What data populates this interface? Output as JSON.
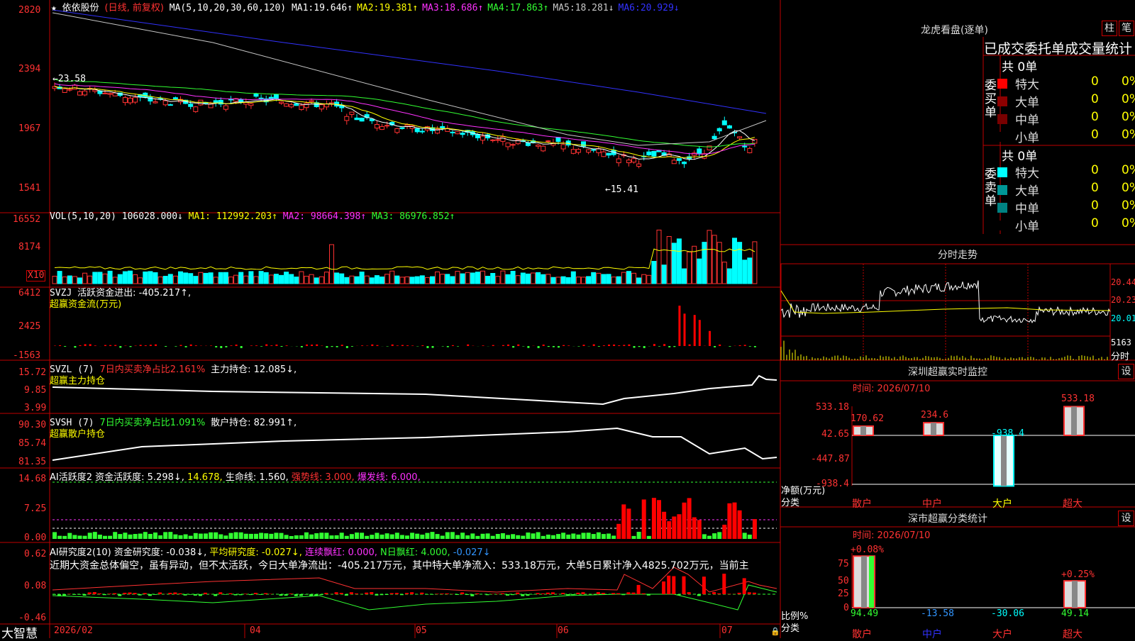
{
  "stock": {
    "title": "依依股份",
    "period": "(日线, 前复权)",
    "ma_label": "MA(5,10,20,30,60,120)",
    "ma": [
      {
        "name": "MA1:",
        "value": "19.646↑",
        "color": "#ffffff"
      },
      {
        "name": "MA2:",
        "value": "19.381↑",
        "color": "#ffff00"
      },
      {
        "name": "MA3:",
        "value": "18.686↑",
        "color": "#ff32ff"
      },
      {
        "name": "MA4:",
        "value": "17.863↑",
        "color": "#32ff32"
      },
      {
        "name": "MA5:",
        "value": "18.281↓",
        "color": "#c8c8c8"
      },
      {
        "name": "MA6:",
        "value": "20.929↓",
        "color": "#3232ff"
      }
    ],
    "y_ticks": [
      "2820",
      "2394",
      "1967",
      "1541"
    ],
    "high_label": "←23.58",
    "low_label": "←15.41"
  },
  "vol": {
    "label": "VOL(5,10,20)",
    "value": "106028.000↓",
    "ma1": "MA1: 112992.203↑",
    "ma2": "MA2: 98664.398↑",
    "ma3": "MA3: 86976.852↑",
    "y_ticks": [
      "16552",
      "8174"
    ],
    "unit": "X10"
  },
  "svzj": {
    "label": "SVZJ",
    "desc": "活跃资金进出: -405.217↑,",
    "sub": "超赢资金流(万元)",
    "y_ticks": [
      "6412",
      "2425",
      "-1563"
    ]
  },
  "svzl": {
    "label": "SVZL (7)",
    "ratio": "7日内买卖净占比2.161%",
    "hold": "主力持仓: 12.085↓,",
    "sub": "超赢主力持仓",
    "y_ticks": [
      "15.72",
      "9.85",
      "3.99"
    ]
  },
  "svsh": {
    "label": "SVSH (7)",
    "ratio": "7日内买卖净占比1.091%",
    "hold": "散户持仓: 82.991↑,",
    "sub": "超赢散户持仓",
    "y_ticks": [
      "90.30",
      "85.74",
      "81.35"
    ]
  },
  "ai1": {
    "label": "AI活跃度2",
    "a": "资金活跃度: 5.298↓,",
    "b": "14.678,",
    "c": "生命线: 1.560,",
    "d": "强势线: 3.000,",
    "e": "爆发线: 6.000,",
    "y_ticks": [
      "14.68",
      "7.25",
      "0.00"
    ]
  },
  "ai2": {
    "label": "AI研究度2(10)",
    "a": "资金研究度: -0.038↓,",
    "b": "平均研究度: -0.027↓,",
    "c": "连续飘红: 0.000,",
    "d": "N日飘红: 4.000,",
    "e": "-0.027↓",
    "comment": "近期大资金总体偏空，虽有异动，但不太活跃，今日大单净流出：-405.217万元，其中特大单净流入：533.18万元，大单5日累计净入4825.702万元，当前主",
    "y_ticks": [
      "0.62",
      "0.08",
      "-0.46"
    ]
  },
  "xaxis": {
    "brand": "大智慧",
    "labels": [
      "2026/02",
      "04",
      "05",
      "06",
      "07"
    ]
  },
  "dragon": {
    "title": "龙虎看盘(逐单)",
    "btn1": "柱",
    "btn2": "笔",
    "header": "已成交委托单成交量统计",
    "buy_label": "委买单",
    "sell_label": "委卖单",
    "buy_total": "共 0单",
    "sell_total": "共 0单",
    "buy_rows": [
      {
        "name": "特大",
        "v1": "0",
        "v2": "0%",
        "color": "#ff0000"
      },
      {
        "name": "大单",
        "v1": "0",
        "v2": "0%",
        "color": "#8c0000"
      },
      {
        "name": "中单",
        "v1": "0",
        "v2": "0%",
        "color": "#780000"
      },
      {
        "name": "小单",
        "v1": "0",
        "v2": "0%",
        "color": "#000000"
      }
    ],
    "sell_rows": [
      {
        "name": "特大",
        "v1": "0",
        "v2": "0%",
        "color": "#00ffff"
      },
      {
        "name": "大单",
        "v1": "0",
        "v2": "0%",
        "color": "#009696"
      },
      {
        "name": "中单",
        "v1": "0",
        "v2": "0%",
        "color": "#008282"
      },
      {
        "name": "小单",
        "v1": "0",
        "v2": "0%",
        "color": "#000000"
      }
    ]
  },
  "intraday": {
    "title": "分时走势",
    "y_ticks": [
      "20.44",
      "20.23",
      "20.01"
    ],
    "vol_tick": "5163",
    "footer": "分时"
  },
  "monitor": {
    "title": "深圳超赢实时监控",
    "btn": "设",
    "time": "时间: 2026/07/10",
    "y_ticks": [
      "533.18",
      "42.65",
      "-447.87",
      "-938.4"
    ],
    "axis_label": "净额(万元)",
    "cat_label": "分类",
    "bars": [
      {
        "cat": "散户",
        "value": 170.62,
        "label": "170.62",
        "cat_color": "#ff3232"
      },
      {
        "cat": "中户",
        "value": 234.6,
        "label": "234.6",
        "cat_color": "#ff3232"
      },
      {
        "cat": "大户",
        "value": -938.4,
        "label": "-938.4",
        "cat_color": "#ffff00"
      },
      {
        "cat": "超大",
        "value": 533.18,
        "label": "533.18",
        "cat_color": "#ff3232"
      }
    ]
  },
  "classify": {
    "title": "深市超赢分类统计",
    "btn": "设",
    "time": "时间: 2026/07/10",
    "y_ticks": [
      "75",
      "50",
      "25",
      "0"
    ],
    "axis_label": "比例%",
    "cat_label": "分类",
    "bars": [
      {
        "cat": "散户",
        "value": 94.49,
        "label": "94.49",
        "top": "+0.08%",
        "cat_color": "#ff3232"
      },
      {
        "cat": "中户",
        "value": -13.58,
        "label": "-13.58",
        "top": "",
        "cat_color": "#3232ff"
      },
      {
        "cat": "大户",
        "value": -30.06,
        "label": "-30.06",
        "top": "",
        "cat_color": "#ff3232"
      },
      {
        "cat": "超大",
        "value": 49.14,
        "label": "49.14",
        "top": "+0.25%",
        "cat_color": "#ff3232"
      }
    ]
  },
  "chart_data": [
    {
      "type": "bar",
      "title": "深圳超赢实时监控",
      "categories": [
        "散户",
        "中户",
        "大户",
        "超大"
      ],
      "values": [
        170.62,
        234.6,
        -938.4,
        533.18
      ],
      "ylabel": "净额(万元)",
      "xlabel": "分类",
      "ylim": [
        -938.4,
        533.18
      ]
    },
    {
      "type": "bar",
      "title": "深市超赢分类统计",
      "categories": [
        "散户",
        "中户",
        "大户",
        "超大"
      ],
      "values": [
        94.49,
        -13.58,
        -30.06,
        49.14
      ],
      "ylabel": "比例%",
      "xlabel": "分类",
      "ylim": [
        0,
        100
      ]
    }
  ]
}
